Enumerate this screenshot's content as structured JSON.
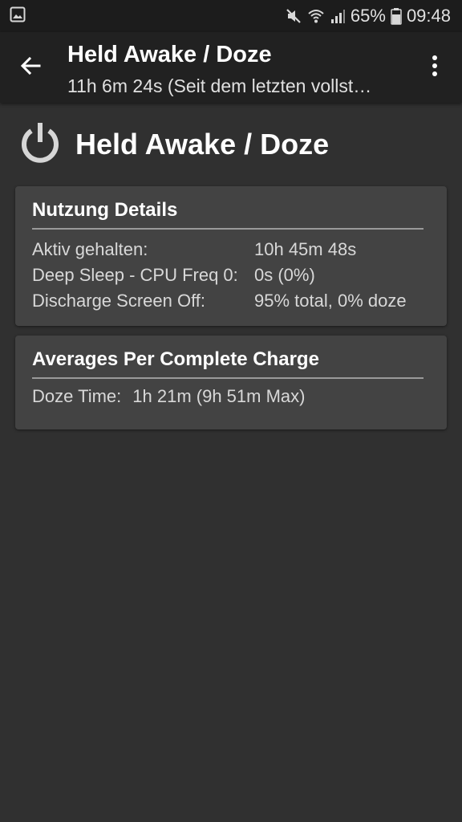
{
  "status_bar": {
    "battery_percent": "65%",
    "time": "09:48",
    "icons": [
      "image-icon",
      "mute-icon",
      "wifi-icon",
      "signal-icon",
      "battery-icon"
    ]
  },
  "app_bar": {
    "title": "Held Awake / Doze",
    "subtitle": "11h 6m 24s (Seit dem letzten vollst…",
    "back_icon": "arrow-left-icon",
    "menu_icon": "more-vert-icon"
  },
  "header": {
    "icon": "power-icon",
    "title": "Held Awake / Doze"
  },
  "usage_card": {
    "title": "Nutzung Details",
    "rows": [
      {
        "label": "Aktiv gehalten:",
        "value": "10h 45m 48s"
      },
      {
        "label": "Deep Sleep - CPU Freq 0:",
        "value": "0s (0%)"
      },
      {
        "label": "Discharge Screen Off:",
        "value": "95% total, 0% doze"
      }
    ]
  },
  "averages_card": {
    "title": "Averages Per Complete Charge",
    "doze_label": "Doze Time:",
    "doze_value": "1h 21m (9h 51m Max)"
  },
  "colors": {
    "background": "#303030",
    "app_bar": "#212121",
    "status_bar": "#1c1c1c",
    "card": "#434343",
    "divider": "#9a9a9a",
    "text_primary": "#ffffff",
    "text_secondary": "#d8d8d8"
  }
}
